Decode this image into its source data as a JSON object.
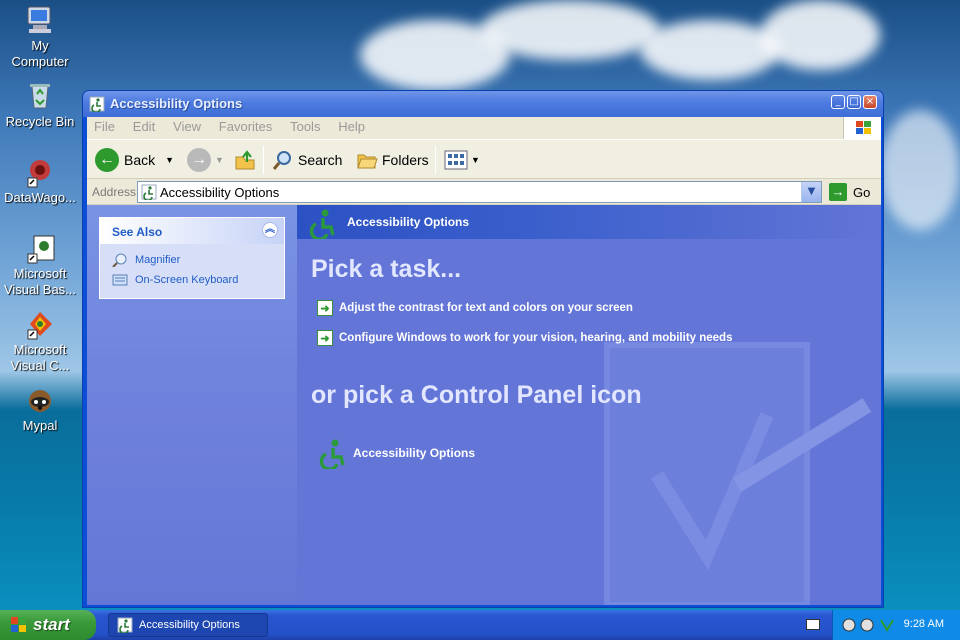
{
  "desktop": {
    "icons": [
      {
        "label_1": "My",
        "label_2": "Computer",
        "icon": "my-computer-icon"
      },
      {
        "label_1": "Recycle Bin",
        "label_2": "",
        "icon": "recycle-bin-icon"
      },
      {
        "label_1": "DataWago...",
        "label_2": "",
        "icon": "datawagon-icon"
      },
      {
        "label_1": "Microsoft",
        "label_2": "Visual Bas...",
        "icon": "visual-basic-icon"
      },
      {
        "label_1": "Microsoft",
        "label_2": "Visual C...",
        "icon": "visual-c-icon"
      },
      {
        "label_1": "Mypal",
        "label_2": "",
        "icon": "mypal-icon"
      }
    ]
  },
  "window": {
    "title": "Accessibility Options",
    "controls": {
      "minimize": "_",
      "maximize": "□",
      "close": "×"
    },
    "menu": [
      "File",
      "Edit",
      "View",
      "Favorites",
      "Tools",
      "Help"
    ],
    "toolbar": {
      "back": "Back",
      "search": "Search",
      "folders": "Folders"
    },
    "address": {
      "label": "Address",
      "value": "Accessibility Options",
      "go": "Go"
    }
  },
  "left_pane": {
    "see_also": {
      "title": "See Also",
      "items": [
        "Magnifier",
        "On-Screen Keyboard"
      ]
    }
  },
  "right_pane": {
    "header": "Accessibility Options",
    "pick_task": "Pick a task...",
    "tasks": [
      "Adjust the contrast for text and colors on your screen",
      "Configure Windows to work for your vision, hearing, and mobility needs"
    ],
    "pick_icon": "or pick a Control Panel icon",
    "cp_icon_label": "Accessibility Options"
  },
  "taskbar": {
    "start": "start",
    "task_item": "Accessibility Options",
    "clock": "9:28 AM"
  },
  "colors": {
    "accent": "#0c4fd6",
    "content_bg": "#6375d6",
    "link": "#215dc6",
    "start_green": "#3a9a3a"
  }
}
